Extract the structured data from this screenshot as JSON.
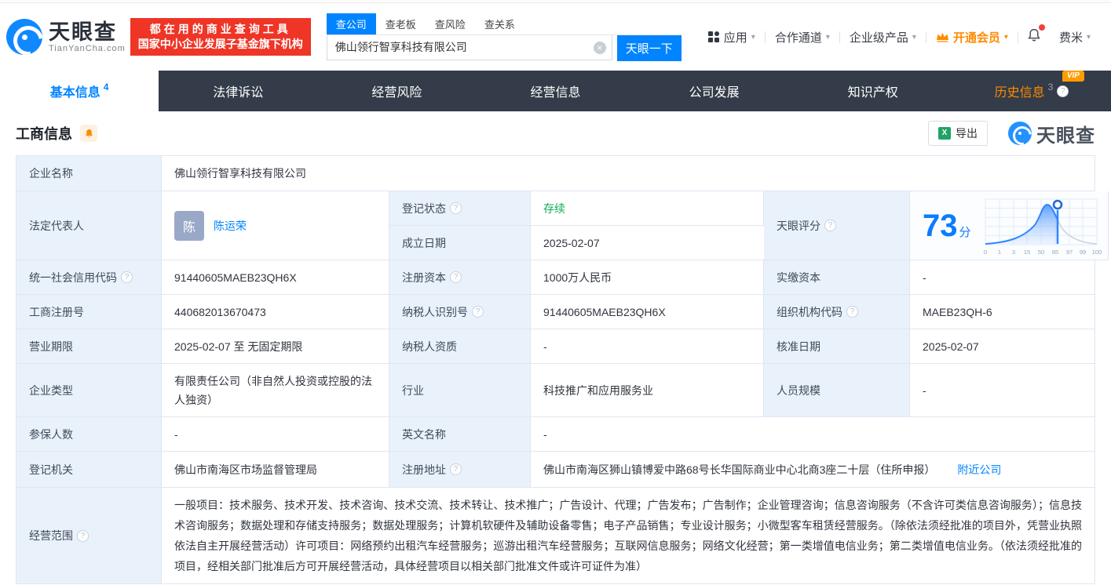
{
  "header": {
    "logo": {
      "name": "天眼查",
      "domain": "TianYanCha.com"
    },
    "promo": {
      "line1": "都在用的商业查询工具",
      "line2": "国家中小企业发展子基金旗下机构"
    },
    "search": {
      "tabs": [
        {
          "label": "查公司"
        },
        {
          "label": "查老板"
        },
        {
          "label": "查风险"
        },
        {
          "label": "查关系"
        }
      ],
      "value": "佛山领行智享科技有限公司",
      "button": "天眼一下"
    },
    "nav": {
      "apps": "应用",
      "partner": "合作通道",
      "enterprise": "企业级产品",
      "vip": "开通会员",
      "user": "费米"
    }
  },
  "tabs": {
    "basic": {
      "label": "基本信息",
      "count": "4"
    },
    "legal": {
      "label": "法律诉讼"
    },
    "risk": {
      "label": "经营风险"
    },
    "operation": {
      "label": "经营信息"
    },
    "development": {
      "label": "公司发展"
    },
    "ip": {
      "label": "知识产权"
    },
    "history": {
      "label": "历史信息",
      "count": "3",
      "badge": "VIP"
    }
  },
  "section": {
    "title": "工商信息",
    "export": "导出",
    "watermark": "天眼查"
  },
  "company": {
    "name": {
      "label": "企业名称",
      "value": "佛山领行智享科技有限公司"
    },
    "legal_rep": {
      "label": "法定代表人",
      "value": "陈运荣",
      "avatar": "陈"
    },
    "reg_status": {
      "label": "登记状态",
      "value": "存续"
    },
    "est_date": {
      "label": "成立日期",
      "value": "2025-02-07"
    },
    "score": {
      "label": "天眼评分",
      "value": "73",
      "unit": "分",
      "axis": [
        "0",
        "1",
        "3",
        "15",
        "50",
        "85",
        "97",
        "99",
        "100"
      ]
    },
    "credit_code": {
      "label": "统一社会信用代码",
      "value": "91440605MAEB23QH6X"
    },
    "reg_capital": {
      "label": "注册资本",
      "value": "1000万人民币"
    },
    "paid_capital": {
      "label": "实缴资本",
      "value": "-"
    },
    "reg_no": {
      "label": "工商注册号",
      "value": "440682013670473"
    },
    "taxpayer_id": {
      "label": "纳税人识别号",
      "value": "91440605MAEB23QH6X"
    },
    "org_code": {
      "label": "组织机构代码",
      "value": "MAEB23QH-6"
    },
    "term": {
      "label": "营业期限",
      "value": "2025-02-07 至 无固定期限"
    },
    "taxpayer_quality": {
      "label": "纳税人资质",
      "value": "-"
    },
    "approve_date": {
      "label": "核准日期",
      "value": "2025-02-07"
    },
    "type": {
      "label": "企业类型",
      "value": "有限责任公司（非自然人投资或控股的法人独资）"
    },
    "industry": {
      "label": "行业",
      "value": "科技推广和应用服务业"
    },
    "staff": {
      "label": "人员规模",
      "value": "-"
    },
    "insured": {
      "label": "参保人数",
      "value": "-"
    },
    "en_name": {
      "label": "英文名称",
      "value": "-"
    },
    "authority": {
      "label": "登记机关",
      "value": "佛山市南海区市场监督管理局"
    },
    "address": {
      "label": "注册地址",
      "value": "佛山市南海区狮山镇博爱中路68号长华国际商业中心北商3座二十层（住所申报）",
      "link": "附近公司"
    },
    "scope": {
      "label": "经营范围",
      "value": "一般项目：技术服务、技术开发、技术咨询、技术交流、技术转让、技术推广；广告设计、代理；广告发布；广告制作；企业管理咨询；信息咨询服务（不含许可类信息咨询服务）；信息技术咨询服务；数据处理和存储支持服务；数据处理服务；计算机软硬件及辅助设备零售；电子产品销售；专业设计服务；小微型客车租赁经营服务。（除依法须经批准的项目外，凭营业执照依法自主开展经营活动）许可项目：网络预约出租汽车经营服务；巡游出租汽车经营服务；互联网信息服务；网络文化经营；第一类增值电信业务；第二类增值电信业务。（依法须经批准的项目，经相关部门批准后方可开展经营活动，具体经营项目以相关部门批准文件或许可证件为准）"
    }
  },
  "colors": {
    "accent": "#0084ff",
    "status_green": "#0bab58",
    "vip_orange": "#ff8a00",
    "promo_red": "#ee3526"
  }
}
